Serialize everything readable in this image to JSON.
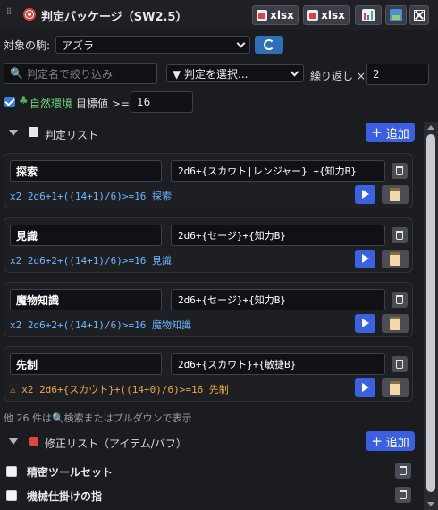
{
  "window": {
    "title": "判定パッケージ（SW2.5）",
    "buttons": [
      {
        "label": "xlsx",
        "icon": "excel-upload-icon"
      },
      {
        "label": "xlsx",
        "icon": "excel-download-icon"
      },
      {
        "label": "",
        "icon": "chart-icon"
      },
      {
        "label": "",
        "icon": "image-icon"
      },
      {
        "label": "",
        "icon": "close-icon"
      }
    ]
  },
  "target": {
    "label": "対象の駒:",
    "selected": "アズラ"
  },
  "filter": {
    "search_placeholder": "判定名で絞り込み",
    "select_placeholder": "▼ 判定を選択...",
    "repeat_label": "繰り返し ×",
    "repeat_value": "2"
  },
  "environment": {
    "checked": true,
    "label": "自然環境",
    "target_label": "目標値 >=",
    "target_value": "16"
  },
  "checks_section": {
    "title": "判定リスト",
    "add_label": "追加",
    "items": [
      {
        "name": "探索",
        "formula": "2d6+{スカウト|レンジャー} +{知力B}",
        "result": "x2 2d6+1+((14+1)/6)>=16 探索",
        "warn": false
      },
      {
        "name": "見識",
        "formula": "2d6+{セージ}+{知力B}",
        "result": "x2 2d6+2+((14+1)/6)>=16 見識",
        "warn": false
      },
      {
        "name": "魔物知識",
        "formula": "2d6+{セージ}+{知力B}",
        "result": "x2 2d6+2+((14+1)/6)>=16 魔物知識",
        "warn": false
      },
      {
        "name": "先制",
        "formula": "2d6+{スカウト}+{敏捷B}",
        "result": "⚠ x2 2d6+{スカウト}+((14+0)/6)>=16 先制",
        "warn": true
      }
    ],
    "more_text": "他 26 件は🔍検索またはプルダウンで表示"
  },
  "modifiers_section": {
    "title": "修正リスト（アイテム/バフ）",
    "add_label": "追加",
    "items": [
      {
        "label": "精密ツールセット",
        "checked": false
      },
      {
        "label": "機械仕掛けの指",
        "checked": false
      }
    ]
  },
  "colors": {
    "accent": "#3a5fe0",
    "result_blue": "#6bb6ff",
    "warn_orange": "#f0a640",
    "env_green": "#6fd07a"
  }
}
